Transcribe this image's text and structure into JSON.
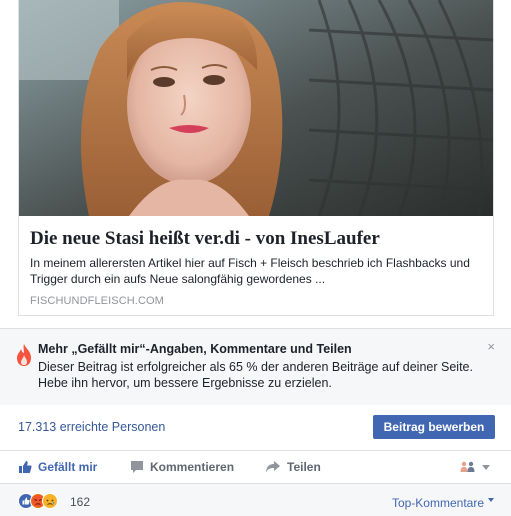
{
  "link_preview": {
    "image_icon": "woman-portrait-photo",
    "title": "Die neue Stasi heißt ver.di - von InesLaufer",
    "description": "In meinem allerersten Artikel hier auf Fisch + Fleisch beschrieb ich Flashbacks und Trigger durch ein aufs Neue salongfähig gewordenes ...",
    "domain": "FISCHUNDFLEISCH.COM"
  },
  "promo": {
    "icon": "flame-icon",
    "title": "Mehr „Gefällt mir“-Angaben, Kommentare und Teilen",
    "text": "Dieser Beitrag ist erfolgreicher als 65 % der anderen Beiträge auf deiner Seite. Hebe ihn hervor, um bessere Ergebnisse zu erzielen.",
    "close_label": "×"
  },
  "reach": {
    "people_reached": "17.313 erreichte Personen",
    "boost_label": "Beitrag bewerben"
  },
  "actions": {
    "like_label": "Gefällt mir",
    "comment_label": "Kommentieren",
    "share_label": "Teilen",
    "audience_icon": "audience-selector-icon"
  },
  "reactions": {
    "icons": [
      "like-reaction-icon",
      "angry-reaction-icon",
      "sad-reaction-icon"
    ],
    "count": "162",
    "sort_label": "Top-Kommentare"
  },
  "colors": {
    "brand_blue": "#4267b2",
    "link_blue": "#365899",
    "border": "#dddfe2",
    "promo_bg": "#f6f7f9",
    "flame": "#f5533d"
  }
}
